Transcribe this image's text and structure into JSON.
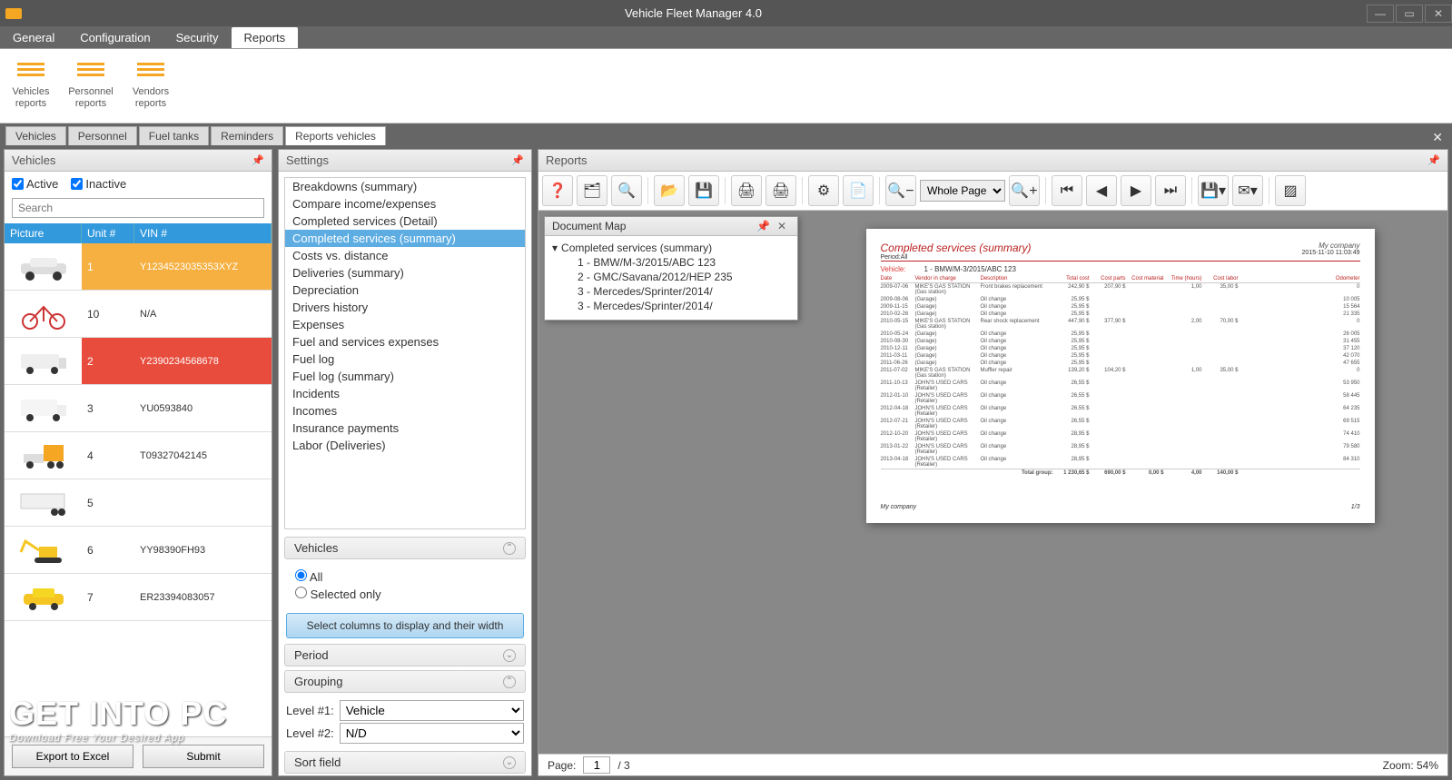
{
  "window": {
    "title": "Vehicle Fleet Manager 4.0"
  },
  "menutabs": [
    "General",
    "Configuration",
    "Security",
    "Reports"
  ],
  "menutab_active": 3,
  "ribbon": [
    {
      "l1": "Vehicles",
      "l2": "reports"
    },
    {
      "l1": "Personnel",
      "l2": "reports"
    },
    {
      "l1": "Vendors",
      "l2": "reports"
    }
  ],
  "doctabs": [
    "Vehicles",
    "Personnel",
    "Fuel tanks",
    "Reminders",
    "Reports vehicles"
  ],
  "doctab_active": 4,
  "panels": {
    "vehicles": "Vehicles",
    "settings": "Settings",
    "reports": "Reports"
  },
  "vehicles": {
    "active_label": "Active",
    "inactive_label": "Inactive",
    "search_placeholder": "Search",
    "cols": {
      "pic": "Picture",
      "unit": "Unit #",
      "vin": "VIN #"
    },
    "rows": [
      {
        "unit": "1",
        "vin": "Y1234523035353XYZ",
        "hl": "hl1",
        "svg": "car"
      },
      {
        "unit": "10",
        "vin": "N/A",
        "hl": "",
        "svg": "bike"
      },
      {
        "unit": "2",
        "vin": "Y2390234568678",
        "hl": "hl2",
        "svg": "van"
      },
      {
        "unit": "3",
        "vin": "YU0593840",
        "hl": "",
        "svg": "van2"
      },
      {
        "unit": "4",
        "vin": "T09327042145",
        "hl": "",
        "svg": "truck"
      },
      {
        "unit": "5",
        "vin": "",
        "hl": "",
        "svg": "trailer"
      },
      {
        "unit": "6",
        "vin": "YY98390FH93",
        "hl": "",
        "svg": "excavator"
      },
      {
        "unit": "7",
        "vin": "ER23394083057",
        "hl": "",
        "svg": "taxi"
      }
    ],
    "export_btn": "Export to Excel",
    "submit_btn": "Submit"
  },
  "settings": {
    "reports": [
      "Breakdowns (summary)",
      "Compare income/expenses",
      "Completed services (Detail)",
      "Completed services (summary)",
      "Costs vs. distance",
      "Deliveries (summary)",
      "Depreciation",
      "Drivers history",
      "Expenses",
      "Fuel and services expenses",
      "Fuel log",
      "Fuel log (summary)",
      "Incidents",
      "Incomes",
      "Insurance payments",
      "Labor (Deliveries)"
    ],
    "selected_report": 3,
    "vehicles_hdr": "Vehicles",
    "all": "All",
    "selonly": "Selected only",
    "colwidth_btn": "Select columns to display and their width",
    "period_hdr": "Period",
    "grouping_hdr": "Grouping",
    "lvl1_lbl": "Level #1:",
    "lvl1_val": "Vehicle",
    "lvl2_lbl": "Level #2:",
    "lvl2_val": "N/D",
    "sort_hdr": "Sort field"
  },
  "toolbar_zoom_sel": "Whole Page",
  "docmap": {
    "title": "Document Map",
    "root": "Completed services (summary)",
    "items": [
      "1 - BMW/M-3/2015/ABC 123",
      "2 - GMC/Savana/2012/HEP 235",
      "3 - Mercedes/Sprinter/2014/",
      "3 - Mercedes/Sprinter/2014/"
    ]
  },
  "report": {
    "title": "Completed services (summary)",
    "company": "My company",
    "timestamp": "2015-11-10 11:03:49",
    "period": "Period:All",
    "vehicle_lbl": "Vehicle:",
    "vehicle": "1 - BMW/M-3/2015/ABC 123",
    "cols": [
      "Date",
      "Vendor in charge",
      "Description",
      "Total cost",
      "Cost parts",
      "Cost material",
      "Time (hours)",
      "Cost labor",
      "Odometer"
    ],
    "rows": [
      {
        "d": "2009-07-06",
        "v": "MIKE'S GAS STATION (Gas station)",
        "desc": "Front brakes replacement",
        "tot": "242,90 $",
        "parts": "207,90 $",
        "mat": "",
        "time": "1,00",
        "labor": "35,00 $",
        "odo": "0"
      },
      {
        "d": "2009-08-06",
        "v": "(Garage)",
        "desc": "Oil change",
        "tot": "25,95 $",
        "parts": "",
        "mat": "",
        "time": "",
        "labor": "",
        "odo": "10 005"
      },
      {
        "d": "2009-11-15",
        "v": "(Garage)",
        "desc": "Oil change",
        "tot": "25,95 $",
        "parts": "",
        "mat": "",
        "time": "",
        "labor": "",
        "odo": "15 564"
      },
      {
        "d": "2010-02-26",
        "v": "(Garage)",
        "desc": "Oil change",
        "tot": "25,95 $",
        "parts": "",
        "mat": "",
        "time": "",
        "labor": "",
        "odo": "21 335"
      },
      {
        "d": "2010-05-15",
        "v": "MIKE'S GAS STATION (Gas station)",
        "desc": "Rear shock replacement",
        "tot": "447,90 $",
        "parts": "377,90 $",
        "mat": "",
        "time": "2,00",
        "labor": "70,00 $",
        "odo": "0"
      },
      {
        "d": "2010-05-24",
        "v": "(Garage)",
        "desc": "Oil change",
        "tot": "25,95 $",
        "parts": "",
        "mat": "",
        "time": "",
        "labor": "",
        "odo": "26 005"
      },
      {
        "d": "2010-08-30",
        "v": "(Garage)",
        "desc": "Oil change",
        "tot": "25,95 $",
        "parts": "",
        "mat": "",
        "time": "",
        "labor": "",
        "odo": "31 455"
      },
      {
        "d": "2010-12-11",
        "v": "(Garage)",
        "desc": "Oil change",
        "tot": "25,95 $",
        "parts": "",
        "mat": "",
        "time": "",
        "labor": "",
        "odo": "37 120"
      },
      {
        "d": "2011-03-11",
        "v": "(Garage)",
        "desc": "Oil change",
        "tot": "25,95 $",
        "parts": "",
        "mat": "",
        "time": "",
        "labor": "",
        "odo": "42 070"
      },
      {
        "d": "2011-06-26",
        "v": "(Garage)",
        "desc": "Oil change",
        "tot": "25,95 $",
        "parts": "",
        "mat": "",
        "time": "",
        "labor": "",
        "odo": "47 655"
      },
      {
        "d": "2011-07-02",
        "v": "MIKE'S GAS STATION (Gas station)",
        "desc": "Muffler repair",
        "tot": "139,20 $",
        "parts": "104,20 $",
        "mat": "",
        "time": "1,00",
        "labor": "35,00 $",
        "odo": "0"
      },
      {
        "d": "2011-10-13",
        "v": "JOHN'S USED CARS (Retailer)",
        "desc": "Oil change",
        "tot": "26,55 $",
        "parts": "",
        "mat": "",
        "time": "",
        "labor": "",
        "odo": "53 950"
      },
      {
        "d": "2012-01-10",
        "v": "JOHN'S USED CARS (Retailer)",
        "desc": "Oil change",
        "tot": "26,55 $",
        "parts": "",
        "mat": "",
        "time": "",
        "labor": "",
        "odo": "58 445"
      },
      {
        "d": "2012-04-18",
        "v": "JOHN'S USED CARS (Retailer)",
        "desc": "Oil change",
        "tot": "26,55 $",
        "parts": "",
        "mat": "",
        "time": "",
        "labor": "",
        "odo": "64 235"
      },
      {
        "d": "2012-07-21",
        "v": "JOHN'S USED CARS (Retailer)",
        "desc": "Oil change",
        "tot": "26,55 $",
        "parts": "",
        "mat": "",
        "time": "",
        "labor": "",
        "odo": "69 515"
      },
      {
        "d": "2012-10-20",
        "v": "JOHN'S USED CARS (Retailer)",
        "desc": "Oil change",
        "tot": "28,95 $",
        "parts": "",
        "mat": "",
        "time": "",
        "labor": "",
        "odo": "74 410"
      },
      {
        "d": "2013-01-22",
        "v": "JOHN'S USED CARS (Retailer)",
        "desc": "Oil change",
        "tot": "28,95 $",
        "parts": "",
        "mat": "",
        "time": "",
        "labor": "",
        "odo": "79 580"
      },
      {
        "d": "2013-04-18",
        "v": "JOHN'S USED CARS (Retailer)",
        "desc": "Oil change",
        "tot": "28,95 $",
        "parts": "",
        "mat": "",
        "time": "",
        "labor": "",
        "odo": "84 310"
      }
    ],
    "total_lbl": "Total group:",
    "totals": [
      "1 230,65 $",
      "690,00 $",
      "0,00 $",
      "4,00",
      "140,00 $"
    ],
    "footer_company": "My company",
    "page_indicator": "1/3"
  },
  "status": {
    "page_lbl": "Page:",
    "page": "1",
    "pages": "/ 3",
    "zoom": "Zoom: 54%"
  },
  "watermark": {
    "text": "GET INTO PC",
    "sub": "Download Free Your Desired App"
  }
}
